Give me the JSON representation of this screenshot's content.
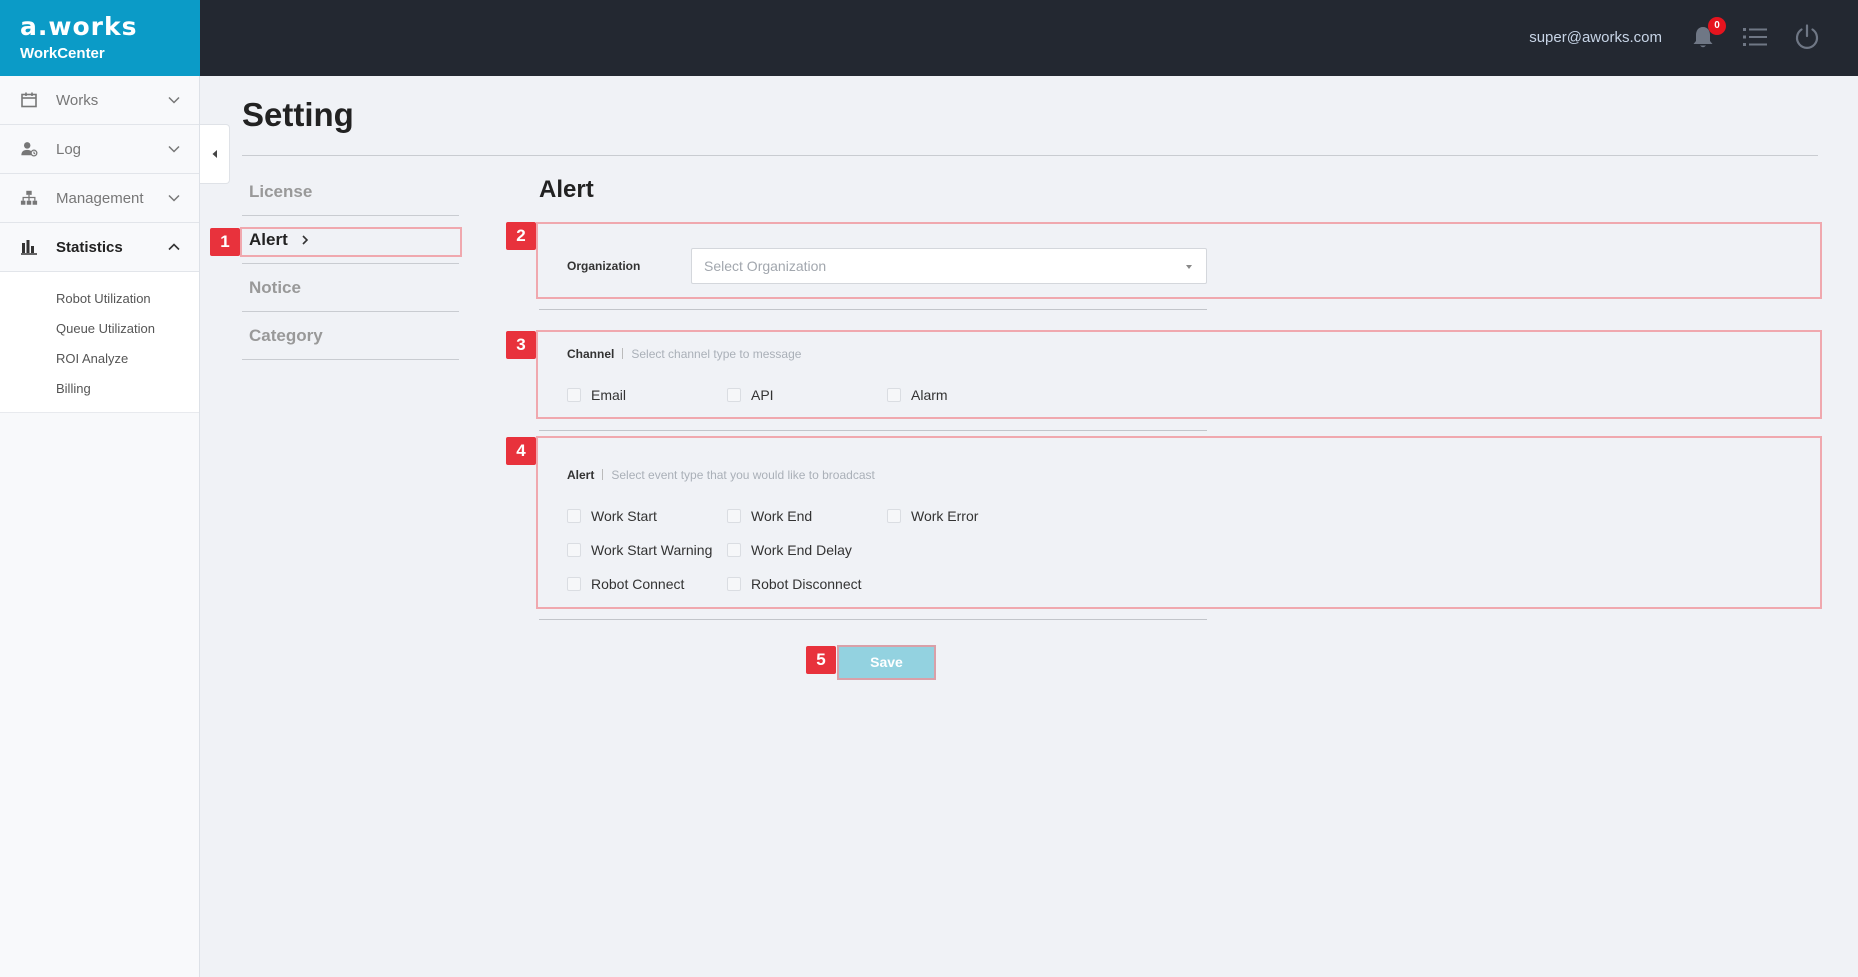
{
  "brand": {
    "logo": "a.works",
    "subtitle": "WorkCenter"
  },
  "sidebar": {
    "items": [
      {
        "label": "Works",
        "icon": "calendar-icon",
        "expanded": false
      },
      {
        "label": "Log",
        "icon": "user-log-icon",
        "expanded": false
      },
      {
        "label": "Management",
        "icon": "org-chart-icon",
        "expanded": false
      },
      {
        "label": "Statistics",
        "icon": "bar-chart-icon",
        "expanded": true
      }
    ],
    "statistics_sub": [
      "Robot Utilization",
      "Queue Utilization",
      "ROI Analyze",
      "Billing"
    ]
  },
  "header": {
    "user_email": "super@aworks.com",
    "notification_count": "0"
  },
  "page": {
    "title": "Setting"
  },
  "setting_nav": {
    "items": [
      "License",
      "Alert",
      "Notice",
      "Category"
    ],
    "active": "Alert"
  },
  "alert_section": {
    "title": "Alert",
    "organization": {
      "label": "Organization",
      "placeholder": "Select Organization"
    },
    "channel": {
      "title": "Channel",
      "description": "Select channel type to message",
      "options": [
        "Email",
        "API",
        "Alarm"
      ]
    },
    "alert": {
      "title": "Alert",
      "description": "Select event type that you would like to broadcast",
      "options": [
        "Work Start",
        "Work End",
        "Work Error",
        "Work Start Warning",
        "Work End Delay",
        "Robot Connect",
        "Robot Disconnect"
      ]
    },
    "save_label": "Save"
  },
  "annotations": [
    "1",
    "2",
    "3",
    "4",
    "5"
  ],
  "colors": {
    "brand": "#0b9bc7",
    "topbar": "#232831",
    "badge": "#e6141e",
    "annotation": "#e8323c",
    "save_button": "#93d2e0"
  }
}
